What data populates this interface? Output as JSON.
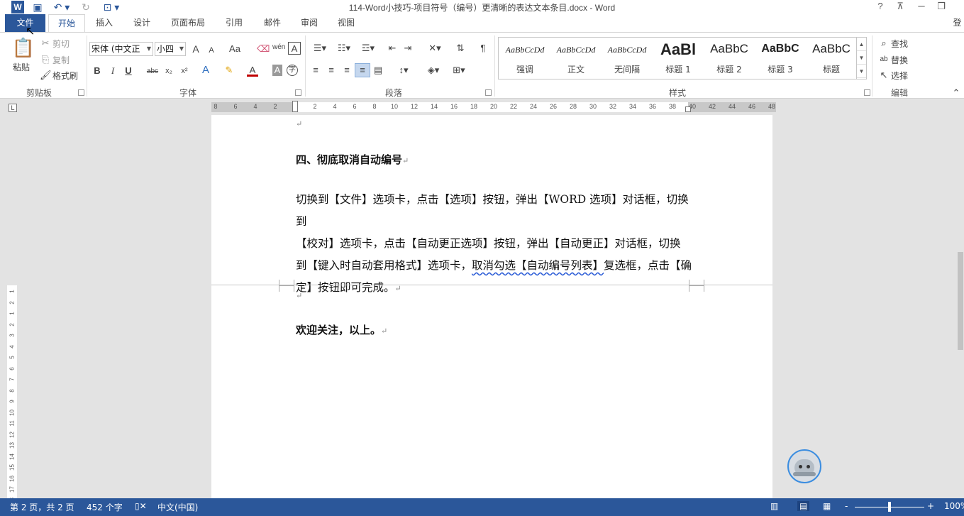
{
  "window": {
    "title": "114-Word小技巧-项目符号（编号）更清晰的表达文本条目.docx - Word",
    "app_icon": "W",
    "help": "?",
    "minimize": "─",
    "restore": "❐",
    "sign_in": "登"
  },
  "tabs": [
    {
      "label": "文件"
    },
    {
      "label": "开始"
    },
    {
      "label": "插入"
    },
    {
      "label": "设计"
    },
    {
      "label": "页面布局"
    },
    {
      "label": "引用"
    },
    {
      "label": "邮件"
    },
    {
      "label": "审阅"
    },
    {
      "label": "视图"
    }
  ],
  "clipboard": {
    "paste": "粘贴",
    "cut": "剪切",
    "copy": "复制",
    "format_painter": "格式刷",
    "group_label": "剪贴板"
  },
  "font": {
    "font_name": "宋体 (中文正",
    "font_size": "小四",
    "grow": "A",
    "shrink": "A",
    "change_case": "Aa",
    "bold": "B",
    "italic": "I",
    "underline": "U",
    "strikethrough": "abc",
    "subscript": "x₂",
    "superscript": "x²",
    "group_label": "字体"
  },
  "paragraph": {
    "group_label": "段落"
  },
  "styles": {
    "items": [
      {
        "sample": "AaBbCcDd",
        "name": "强调"
      },
      {
        "sample": "AaBbCcDd",
        "name": "正文"
      },
      {
        "sample": "AaBbCcDd",
        "name": "无间隔"
      },
      {
        "sample": "AaBl",
        "name": "标题 1"
      },
      {
        "sample": "AaBbC",
        "name": "标题 2"
      },
      {
        "sample": "AaBbC",
        "name": "标题 3"
      },
      {
        "sample": "AaBbC",
        "name": "标题"
      }
    ],
    "group_label": "样式"
  },
  "editing": {
    "find": "查找",
    "replace": "替换",
    "select": "选择",
    "group_label": "编辑"
  },
  "ruler": {
    "ticks": [
      "8",
      "6",
      "4",
      "2",
      "",
      "2",
      "4",
      "6",
      "8",
      "10",
      "12",
      "14",
      "16",
      "18",
      "20",
      "22",
      "24",
      "26",
      "28",
      "30",
      "32",
      "34",
      "36",
      "38",
      "40",
      "42",
      "44",
      "46",
      "48"
    ],
    "vticks": [
      "1",
      "2",
      "1",
      "2",
      "3",
      "4",
      "5",
      "6",
      "7",
      "8",
      "9",
      "10",
      "11",
      "12",
      "13",
      "14",
      "15",
      "16",
      "17",
      "18"
    ]
  },
  "document": {
    "heading_4": "四、彻底取消自动编号",
    "para_line1": "切换到【文件】选项卡，点击【选项】按钮，弹出【WORD 选项】对话框，切换到",
    "para_line2": "【校对】选项卡，点击【自动更正选项】按钮，弹出【自动更正】对话框，切换",
    "para_line3_a": "到【键入时自动套用格式】选项卡，",
    "para_line3_b": "取消勾选【自动编号列表】",
    "para_line3_c": "复选框，点击【确",
    "para_line4": "定】按钮即可完成。",
    "closing": "欢迎关注，以上。",
    "return_mark": "↵"
  },
  "status": {
    "page": "第 2 页，共 2 页",
    "words": "452 个字",
    "language": "中文(中国)",
    "zoom_minus": "-",
    "zoom_plus": "+",
    "zoom": "100%"
  }
}
